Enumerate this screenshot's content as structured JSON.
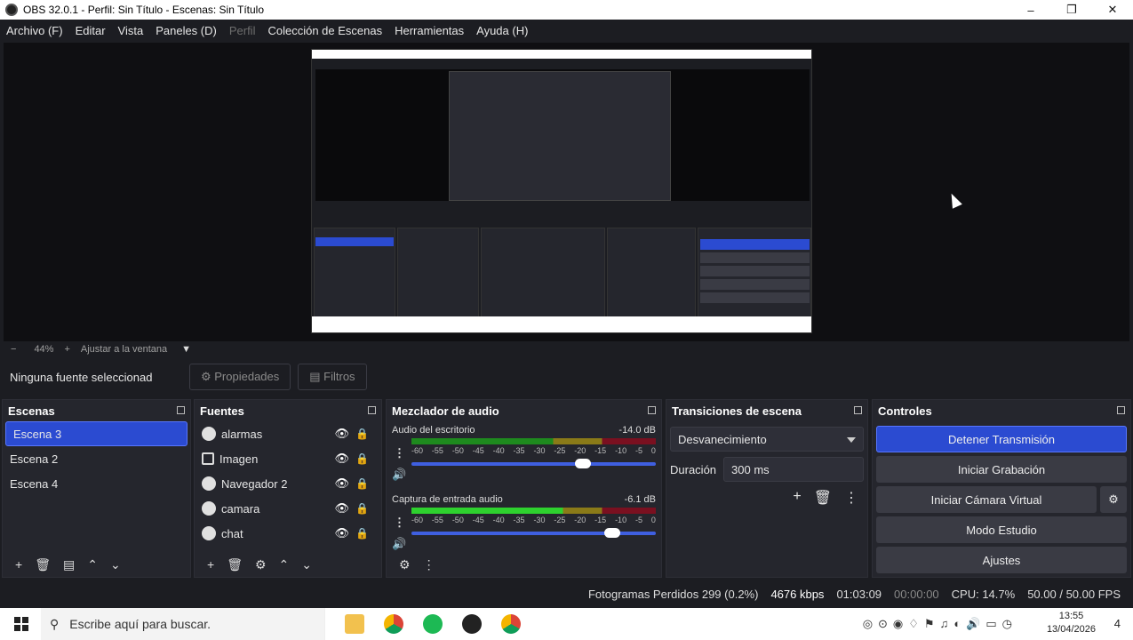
{
  "window": {
    "title": "OBS 32.0.1 - Perfil: Sin Título - Escenas: Sin Título",
    "min": "–",
    "max": "❐",
    "close": "✕"
  },
  "menu": [
    "Archivo (F)",
    "Editar",
    "Vista",
    "Paneles (D)",
    "Perfil",
    "Colección de Escenas",
    "Herramientas",
    "Ayuda (H)"
  ],
  "zoom": {
    "minus": "−",
    "value": "44%",
    "plus": "+",
    "fit": "Ajustar a la ventana",
    "arrow": "▼"
  },
  "sourcebar": {
    "label": "Ninguna fuente seleccionad",
    "properties": "⚙ Propiedades",
    "filters": "▤ Filtros"
  },
  "scenes": {
    "title": "Escenas",
    "items": [
      "Escena 3",
      "Escena 2",
      "Escena 4"
    ],
    "selected": 0
  },
  "sources": {
    "title": "Fuentes",
    "items": [
      "alarmas",
      "Imagen",
      "Navegador 2",
      "camara",
      "chat"
    ]
  },
  "mixer": {
    "title": "Mezclador de audio",
    "channels": [
      {
        "name": "Audio del escritorio",
        "db": "-14.0 dB",
        "level": 0.7
      },
      {
        "name": "Captura de entrada audio",
        "db": "-6.1 dB",
        "level": 0.82
      }
    ],
    "ticks": [
      "-60",
      "-55",
      "-50",
      "-45",
      "-40",
      "-35",
      "-30",
      "-25",
      "-20",
      "-15",
      "-10",
      "-5",
      "0"
    ]
  },
  "transitions": {
    "title": "Transiciones de escena",
    "selected": "Desvanecimiento",
    "duration_label": "Duración",
    "duration": "300 ms"
  },
  "controls": {
    "title": "Controles",
    "stream": "Detener Transmisión",
    "record": "Iniciar Grabación",
    "vcam": "Iniciar Cámara Virtual",
    "studio": "Modo Estudio",
    "settings": "Ajustes"
  },
  "status": {
    "dropped": "Fotogramas Perdidos 299 (0.2%)",
    "bitrate": "4676 kbps",
    "stream_time": "01:03:09",
    "rec_time": "00:00:00",
    "cpu": "CPU: 14.7%",
    "fps": "50.00 / 50.00 FPS"
  },
  "taskbar": {
    "search": "Escribe aquí para buscar.",
    "time": "13:55",
    "date": "13/04/2026",
    "notif": "4"
  },
  "colors": {
    "accent": "#2b4bd1",
    "bg": "#1c1d22",
    "dock": "#25262d"
  }
}
